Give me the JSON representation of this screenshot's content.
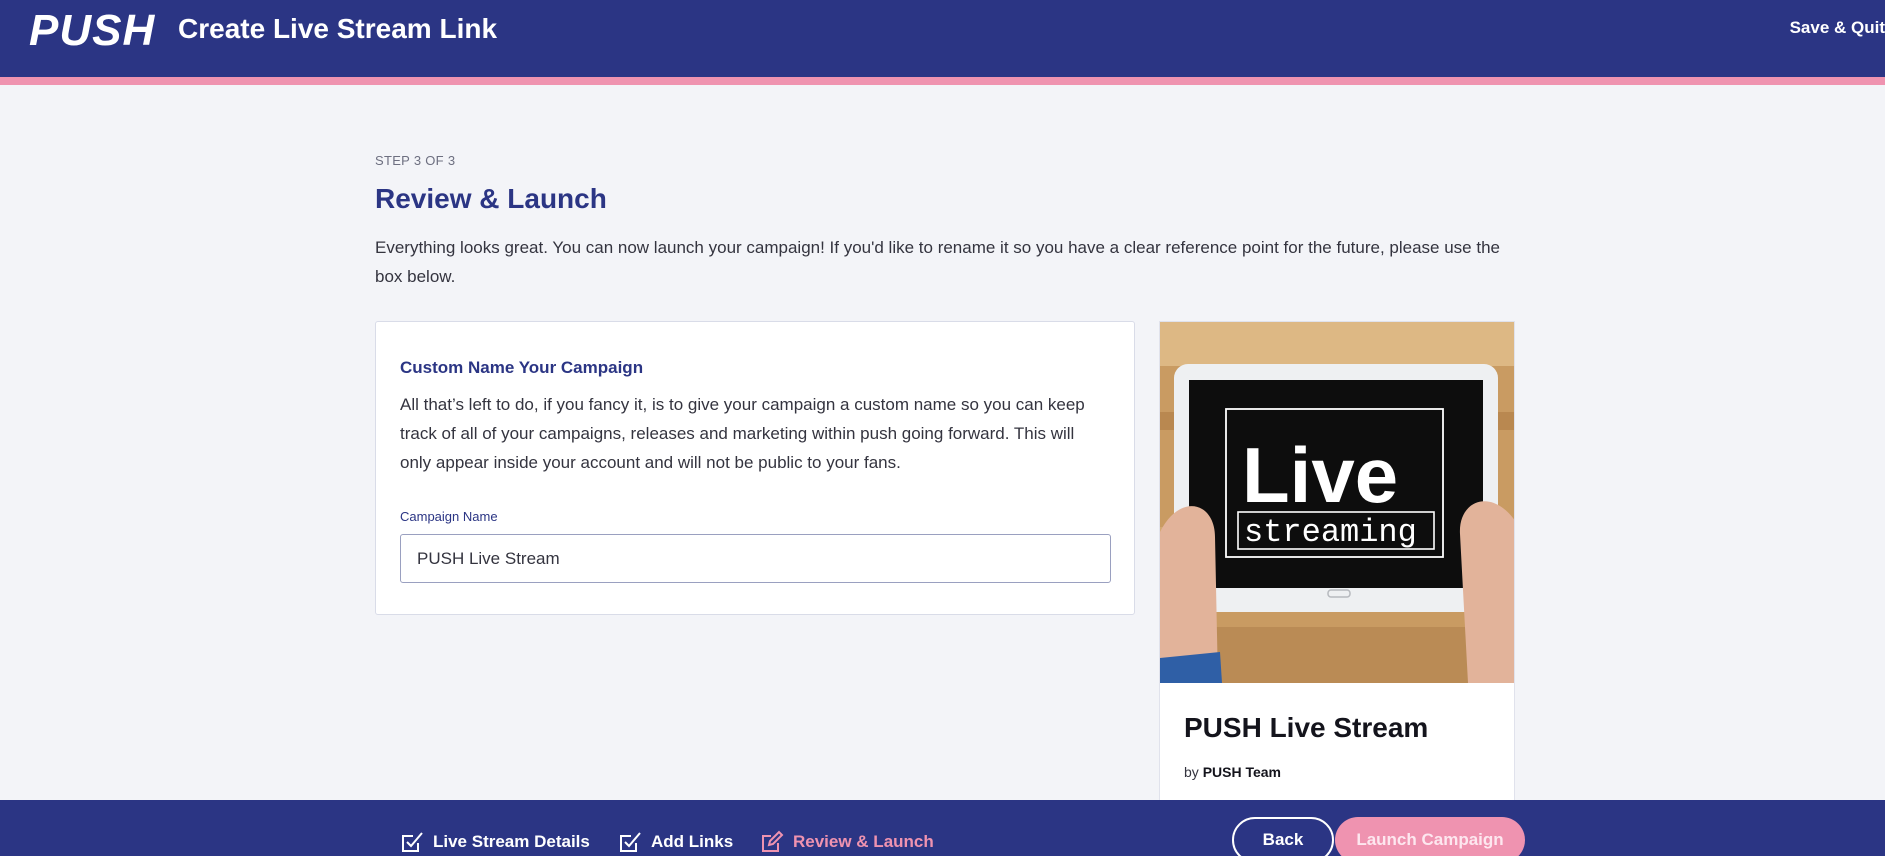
{
  "header": {
    "logo": "PUSH",
    "title": "Create Live Stream Link",
    "save_quit": "Save & Quit"
  },
  "review": {
    "step": "STEP 3 OF 3",
    "title": "Review & Launch",
    "intro": "Everything looks great. You can now launch your campaign! If you'd like to rename it so you have a clear reference point for the future, please use the box below."
  },
  "custom_name": {
    "title": "Custom Name Your Campaign",
    "description": "All that’s left to do, if you fancy it, is to give your campaign a custom name so you can keep track of all of your campaigns, releases and marketing within push going forward. This will only appear inside your account and will not be public to your fans.",
    "field_label": "Campaign Name",
    "field_value": "PUSH Live Stream"
  },
  "preview": {
    "image_text_line1": "Live",
    "image_text_line2": "streaming",
    "title": "PUSH Live Stream",
    "by_prefix": "by",
    "author": "PUSH Team"
  },
  "footer": {
    "steps": [
      {
        "label": "Live Stream Details",
        "icon": "checkbox-check-icon",
        "state": "done"
      },
      {
        "label": "Add Links",
        "icon": "checkbox-check-icon",
        "state": "done"
      },
      {
        "label": "Review & Launch",
        "icon": "edit-pencil-icon",
        "state": "active"
      }
    ],
    "back": "Back",
    "launch": "Launch Campaign"
  },
  "colors": {
    "navy": "#2b3584",
    "pink": "#ef93b0",
    "background": "#f3f4f8"
  }
}
